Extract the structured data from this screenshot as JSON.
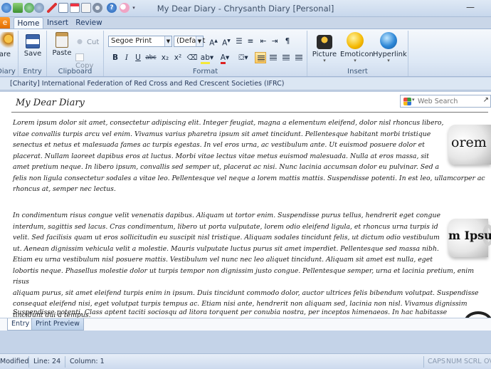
{
  "window": {
    "title": "My Dear Diary - Chrysanth Diary [Personal]",
    "minimize_glyph": "—"
  },
  "tabs": {
    "home": "Home",
    "insert": "Insert",
    "review": "Review"
  },
  "ribbon": {
    "diary_group": {
      "button": "are",
      "label": "Diary"
    },
    "entry_group": {
      "save": "Save",
      "label": "Entry"
    },
    "clipboard_group": {
      "paste": "Paste",
      "cut": "Cut",
      "copy": "Copy",
      "label": "Clipboard"
    },
    "format_group": {
      "font_name": "Segoe Print",
      "font_size": "(Default",
      "bold": "B",
      "italic": "I",
      "underline": "U",
      "strikethrough": "abc",
      "subscript": "x₂",
      "superscript": "x²",
      "label": "Format"
    },
    "insert_group": {
      "picture": "Picture",
      "emoticon": "Emoticon",
      "hyperlink": "Hyperlink",
      "label": "Insert"
    }
  },
  "charity_text": "[Charity] International Federation of Red Cross and Red Crescent Societies (IFRC)",
  "document": {
    "title": "My Dear Diary",
    "search_placeholder": "Web Search",
    "paragraphs": [
      "Lorem ipsum dolor sit amet, consectetur adipiscing elit. Integer feugiat, magna a elementum eleifend, dolor nisl rhoncus libero,\nvitae convallis turpis arcu vel enim. Vivamus varius pharetra ipsum sit amet tincidunt. Pellentesque habitant morbi tristique\nsenectus et netus et malesuada fames ac turpis egestas. In vel eros urna, ac vestibulum ante. Ut euismod posuere dolor et\nplacerat. Nullam laoreet dapibus eros at luctus. Morbi vitae lectus vitae metus euismod malesuada. Nulla at eros massa, sit\namet pretium neque. In libero ipsum, convallis sed semper ut, placerat ac nisi. Nunc lacinia accumsan dolor eu pulvinar. Sed a\nfelis non ligula consectetur sodales a vitae leo. Pellentesque vel neque a lorem mattis mattis. Suspendisse potenti. In est leo, ullamcorper ac\nrhoncus at, semper nec lectus.",
      "In condimentum risus congue velit venenatis dapibus. Aliquam ut tortor enim. Suspendisse purus tellus, hendrerit eget congue\ninterdum, sagittis sed lacus. Cras condimentum, libero ut porta vulputate, lorem odio eleifend ligula, et rhoncus urna turpis id\nvelit. Sed facilisis quam ut eros sollicitudin eu suscipit nisl tristique. Aliquam sodales tincidunt felis, ut dictum odio vestibulum\nut. Aenean dignissim vehicula velit a molestie. Mauris vulputate luctus purus sit amet imperdiet. Pellentesque sed massa nibh.\nEtiam eu urna vestibulum nisl posuere mattis. Vestibulum vel nunc nec leo aliquet tincidunt. Aliquam sit amet est nulla, eget\nlobortis neque. Phasellus molestie dolor ut turpis tempor non dignissim justo congue. Pellentesque semper, urna et lacinia pretium, enim risus\naliquam purus, sit amet eleifend turpis enim in ipsum. Duis tincidunt commodo dolor, auctor ultrices felis bibendum volutpat. Suspendisse\nconsequat eleifend nisi, eget volutpat turpis tempus ac. Etiam nisi ante, hendrerit non aliquam sed, lacinia non nisl. Vivamus dignissim\ntincidunt dui a tempus.",
      "Suspendisse potenti. Class aptent taciti sociosqu ad litora torquent per conubia nostra, per inceptos himenaeos. In hac habitasse"
    ],
    "mug1_text": "orem Ip",
    "mug2_text": "m Ipsun"
  },
  "bottom_tabs": {
    "entry": "Entry",
    "print_preview": "Print Preview"
  },
  "status": {
    "mode": "Modified",
    "line": "Line: 24",
    "column": "Column: 1",
    "caps": "CAPS",
    "num": "NUM",
    "scrl": "SCRL",
    "ovr": "OV"
  },
  "colors": {
    "ribbon_bg": "#dde8f5",
    "accent_orange": "#e06b00",
    "highlight_button": "#ffc95c"
  }
}
